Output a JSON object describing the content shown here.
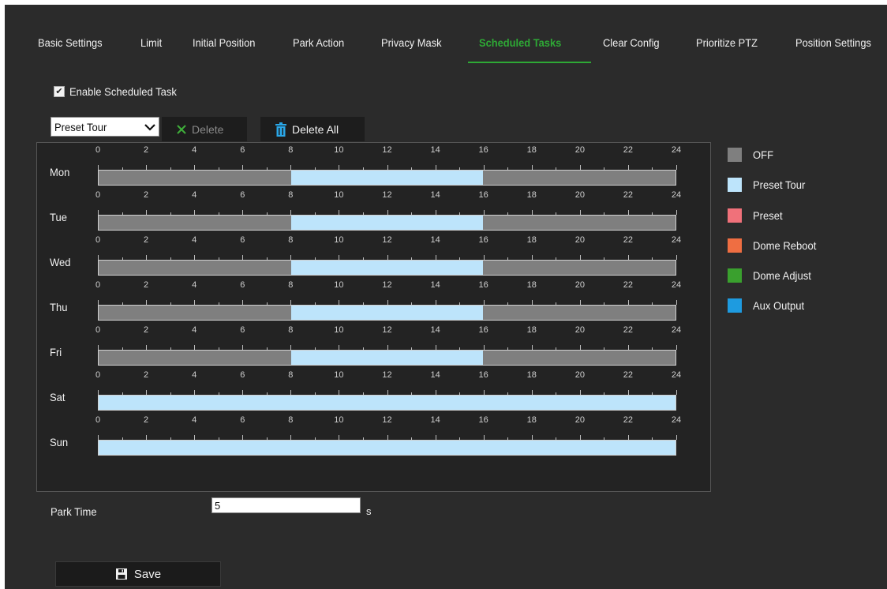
{
  "tabs": [
    {
      "label": "Basic Settings",
      "active": false
    },
    {
      "label": "Limit",
      "active": false
    },
    {
      "label": "Initial Position",
      "active": false
    },
    {
      "label": "Park Action",
      "active": false
    },
    {
      "label": "Privacy Mask",
      "active": false
    },
    {
      "label": "Scheduled Tasks",
      "active": true
    },
    {
      "label": "Clear Config",
      "active": false
    },
    {
      "label": "Prioritize PTZ",
      "active": false
    },
    {
      "label": "Position Settings",
      "active": false
    }
  ],
  "enable": {
    "label": "Enable Scheduled Task",
    "checked": true
  },
  "toolbar": {
    "task_select": {
      "selected": "Preset Tour"
    },
    "delete_label": "Delete",
    "delete_all_label": "Delete All"
  },
  "schedule": {
    "hour_ticks": [
      "0",
      "2",
      "4",
      "6",
      "8",
      "10",
      "12",
      "14",
      "16",
      "18",
      "20",
      "22",
      "24"
    ],
    "days": [
      {
        "name": "Mon",
        "segments": [
          {
            "start": 8,
            "end": 16,
            "task": "Preset Tour"
          }
        ]
      },
      {
        "name": "Tue",
        "segments": [
          {
            "start": 8,
            "end": 16,
            "task": "Preset Tour"
          }
        ]
      },
      {
        "name": "Wed",
        "segments": [
          {
            "start": 8,
            "end": 16,
            "task": "Preset Tour"
          }
        ]
      },
      {
        "name": "Thu",
        "segments": [
          {
            "start": 8,
            "end": 16,
            "task": "Preset Tour"
          }
        ]
      },
      {
        "name": "Fri",
        "segments": [
          {
            "start": 8,
            "end": 16,
            "task": "Preset Tour"
          }
        ]
      },
      {
        "name": "Sat",
        "segments": [
          {
            "start": 0,
            "end": 24,
            "task": "Preset Tour"
          }
        ]
      },
      {
        "name": "Sun",
        "segments": [
          {
            "start": 0,
            "end": 24,
            "task": "Preset Tour"
          }
        ]
      }
    ]
  },
  "legend": [
    {
      "label": "OFF",
      "color": "#7f7f7f"
    },
    {
      "label": "Preset Tour",
      "color": "#bde4fb"
    },
    {
      "label": "Preset",
      "color": "#f0717a"
    },
    {
      "label": "Dome Reboot",
      "color": "#ef6e42"
    },
    {
      "label": "Dome Adjust",
      "color": "#3aa02e"
    },
    {
      "label": "Aux Output",
      "color": "#1e9be0"
    }
  ],
  "park_time": {
    "label": "Park Time",
    "value": "5",
    "unit": "s"
  },
  "save_label": "Save",
  "colors": {
    "accent": "#2ea935"
  }
}
